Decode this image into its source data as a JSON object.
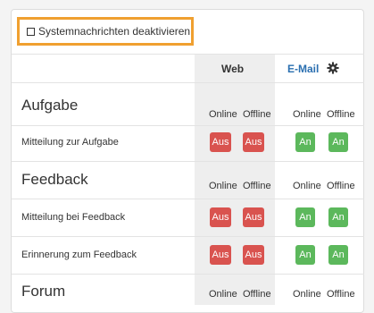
{
  "settings": {
    "disable_notifications_label": "Systemnachrichten deaktivieren",
    "disable_notifications_checked": false
  },
  "columns": {
    "web": "Web",
    "email": "E-Mail"
  },
  "sublabels": {
    "online": "Online",
    "offline": "Offline"
  },
  "sections": [
    {
      "title": "Aufgabe",
      "rows": [
        {
          "label": "Mitteilung zur Aufgabe",
          "web_online": "Aus",
          "web_offline": "Aus",
          "email_online": "An",
          "email_offline": "An"
        }
      ]
    },
    {
      "title": "Feedback",
      "rows": [
        {
          "label": "Mitteilung bei Feedback",
          "web_online": "Aus",
          "web_offline": "Aus",
          "email_online": "An",
          "email_offline": "An"
        },
        {
          "label": "Erinnerung zum Feedback",
          "web_online": "Aus",
          "web_offline": "Aus",
          "email_online": "An",
          "email_offline": "An"
        }
      ]
    },
    {
      "title": "Forum",
      "rows": []
    }
  ],
  "colors": {
    "off": "#d9534f",
    "on": "#5cb85c",
    "highlight": "#f0a030",
    "email_header": "#2a6fb0"
  }
}
